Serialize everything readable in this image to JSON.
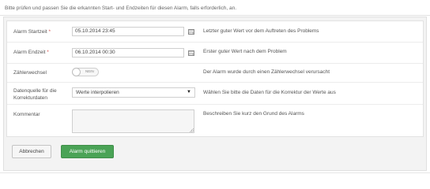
{
  "intro": "Bitte prüfen und passen Sie die erkannten Start- und Endzeiten für diesen Alarm, falls erforderlich, an.",
  "rows": {
    "start": {
      "label": "Alarm Startzeit",
      "required_mark": "*",
      "value": "05.10.2014 23:45",
      "help": "Letzter guter Wert vor dem Auftreten des Problems"
    },
    "end": {
      "label": "Alarm Endzeit",
      "required_mark": "*",
      "value": "06.10.2014 00:30",
      "help": "Erster guter Wert nach dem Problem"
    },
    "counter": {
      "label": "Zählerwechsel",
      "toggle_text": "NEIN",
      "help": "Der Alarm wurde durch einen Zählerwechsel verursacht"
    },
    "source": {
      "label": "Datenquelle für die Korrekturdaten",
      "selected": "Werte interpolieren",
      "help": "Wählen Sie bitte die Daten für die Korrektur der Werte aus"
    },
    "comment": {
      "label": "Kommentar",
      "value": "",
      "help": "Beschreiben Sie kurz den Grund des Alarms"
    }
  },
  "buttons": {
    "cancel": "Abbrechen",
    "confirm": "Alarm quittieren"
  },
  "colors": {
    "confirm_button": "#4aa356",
    "required": "#d9534f"
  }
}
